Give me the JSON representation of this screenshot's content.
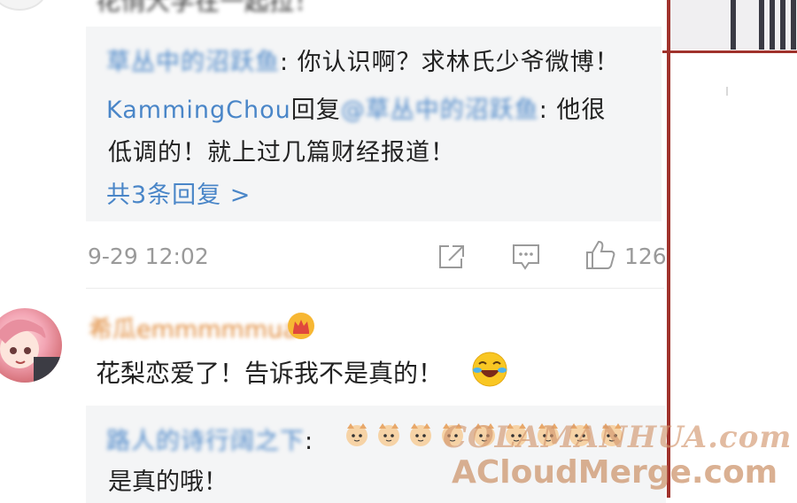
{
  "top_comment": {
    "text_partial": "花悄大学在一起拉！"
  },
  "reply_thread": {
    "reply1": {
      "user": "草丛中的沼跃鱼",
      "text": ": 你认识啊？求林氏少爷微博！"
    },
    "reply2": {
      "user": "KammingChou",
      "reply_word": "回复",
      "mention": "@草丛中的沼跃鱼",
      "text_line1": ": 他很",
      "text_line2": "低调的！就上过几篇财经报道！"
    },
    "more_replies": "共3条回复 >"
  },
  "comment_meta": {
    "time": "9-29 12:02",
    "likes": "126"
  },
  "second_comment": {
    "username": "希瓜emmmmmua",
    "text": "花梨恋爱了！告诉我不是真的！",
    "emoji": "laughing-crying-emoji"
  },
  "second_thread": {
    "reply_user": "路人的诗行阔之下",
    "reply_sep": ":",
    "reply_text_emojis": [
      "cat-emoji",
      "cat-emoji",
      "cat-emoji",
      "cat-emoji",
      "cat-emoji",
      "cat-emoji",
      "cat-emoji",
      "cat-emoji",
      "cat-emoji"
    ],
    "reply2_text": "是真的哦！"
  },
  "watermark": {
    "line1": "COLAMANHUA.com",
    "line2": "ACloudMerge.com"
  },
  "colors": {
    "link_blue": "#4a86c8",
    "meta_gray": "#9a9a9a",
    "panel_red": "#a0322c",
    "watermark_orange": "#d2966e"
  }
}
